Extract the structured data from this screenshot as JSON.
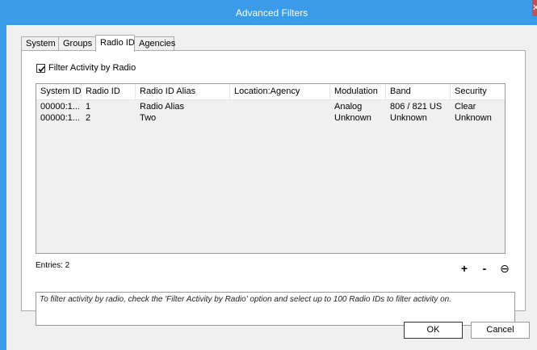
{
  "window": {
    "title": "Advanced Filters",
    "close_label": "✕",
    "titlebar_color": "#3a9ce8"
  },
  "tabs": [
    {
      "label": "System"
    },
    {
      "label": "Groups"
    },
    {
      "label": "Radio ID",
      "active": true
    },
    {
      "label": "Agencies"
    }
  ],
  "filter": {
    "label": "Filter Activity by Radio",
    "checked": true
  },
  "grid": {
    "columns": [
      "System ID",
      "Radio ID",
      "Radio ID Alias",
      "Location:Agency",
      "Modulation",
      "Band",
      "Security"
    ],
    "rows": [
      [
        "00000:1...",
        "1",
        "Radio Alias",
        "",
        "Analog",
        "806 / 821 US",
        "Clear"
      ],
      [
        "00000:1...",
        "2",
        "Two",
        "",
        "Unknown",
        "Unknown",
        "Unknown"
      ]
    ],
    "entries_label": "Entries: 2"
  },
  "grid_buttons": {
    "add": "+",
    "remove": "-",
    "clear": "⊖"
  },
  "hint": "To filter activity by radio, check the 'Filter Activity by Radio' option and select up to 100 Radio IDs to filter activity on.",
  "buttons": {
    "ok": "OK",
    "cancel": "Cancel"
  }
}
